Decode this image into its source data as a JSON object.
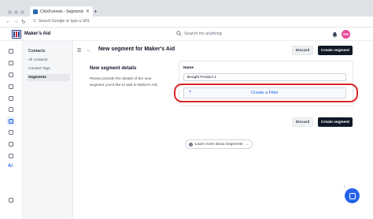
{
  "browser": {
    "tab_title": "ClickFunnels - Segments",
    "tab_close": "✕",
    "new_tab": "+",
    "address_placeholder": "Search Google or type a URL"
  },
  "app": {
    "name": "Maker's Aid",
    "search_placeholder": "Search for anything",
    "avatar_initials": "DN"
  },
  "sidebar": {
    "heading": "Contacts",
    "items": [
      {
        "label": "All contacts",
        "active": false
      },
      {
        "label": "Contact Tags",
        "active": false
      },
      {
        "label": "Segments",
        "active": true
      }
    ]
  },
  "rail": {
    "icons": [
      "home-icon",
      "contacts-icon",
      "funnel-icon",
      "sites-icon",
      "store-icon",
      "layout-icon",
      "segments-icon",
      "analytics-icon",
      "automation-icon",
      "calendar-icon",
      "integrations-icon",
      "settings-icon"
    ],
    "ai_label": "Ai",
    "bottom_icon": "logout-icon"
  },
  "page": {
    "title": "New segment for Maker's Aid",
    "discard_label": "Discard",
    "create_label": "Create segment"
  },
  "details": {
    "title": "New segment details",
    "description": "Please provide the details of the new segment you'd like to add to Maker's Aid."
  },
  "form": {
    "name_label": "Name",
    "name_value": "Bought Product 1",
    "filter_icon": "+",
    "filter_label": "Create a Filter"
  },
  "learn_more": {
    "icon": "?",
    "label": "Learn more about Segments",
    "arrow": "→"
  },
  "colors": {
    "primary": "#2563eb",
    "dark_button": "#111827",
    "highlight": "#dc2626"
  }
}
